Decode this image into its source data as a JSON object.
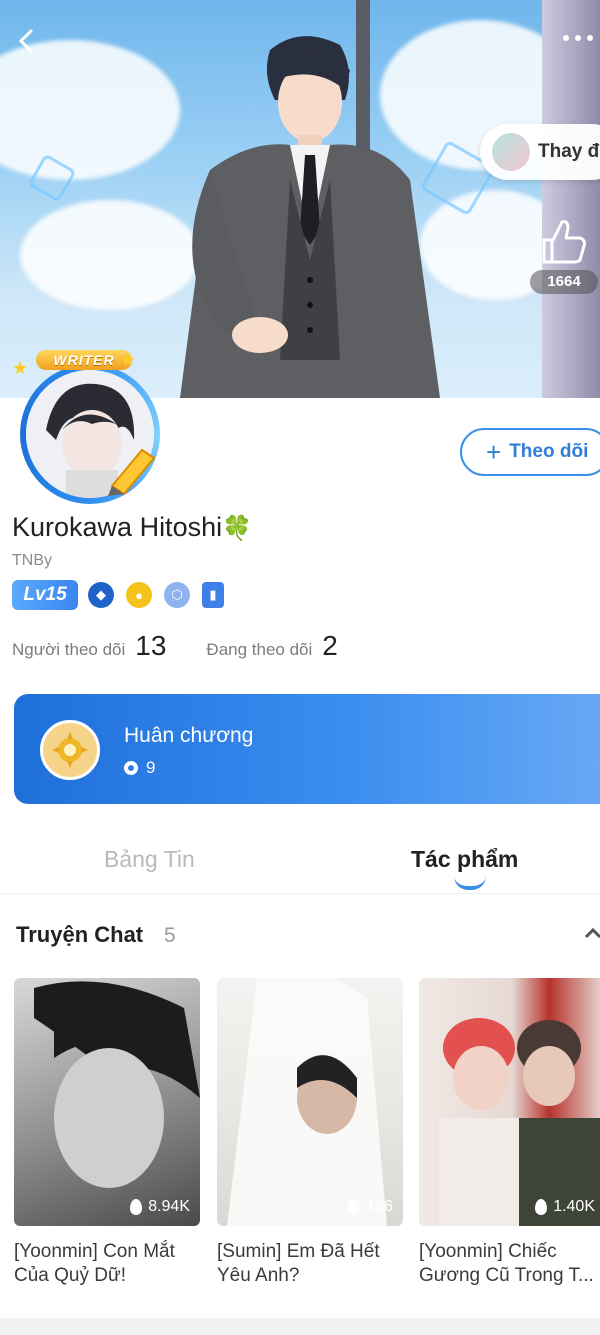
{
  "header": {
    "back_icon": "back-chevron-icon",
    "more_icon": "more-dots-icon",
    "change_label": "Thay đ",
    "like_count": "1664"
  },
  "profile": {
    "badge_label": "WRITER",
    "name": "Kurokawa Hitoshi",
    "name_emoji": "🍀",
    "handle": "TNBy",
    "level": "Lv15",
    "follow_label": "Theo dõi",
    "followers_label": "Người theo dõi",
    "followers_count": "13",
    "following_label": "Đang theo dõi",
    "following_count": "2"
  },
  "medal": {
    "title": "Huân chương",
    "count": "9"
  },
  "tabs": [
    {
      "label": "Bảng Tin",
      "active": false
    },
    {
      "label": "Tác phẩm",
      "active": true
    }
  ],
  "section": {
    "title": "Truyện Chat",
    "count": "5"
  },
  "stories": [
    {
      "title": "[Yoonmin] Con Mắt Của Quỷ Dữ!",
      "views": "8.94K"
    },
    {
      "title": "[Sumin] Em Đã Hết Yêu Anh?",
      "views": "126"
    },
    {
      "title": "[Yoonmin] Chiếc Gương Cũ Trong T...",
      "views": "1.40K"
    }
  ],
  "colors": {
    "accent": "#3b8fe8",
    "medal_card": "#2f7fe0"
  }
}
